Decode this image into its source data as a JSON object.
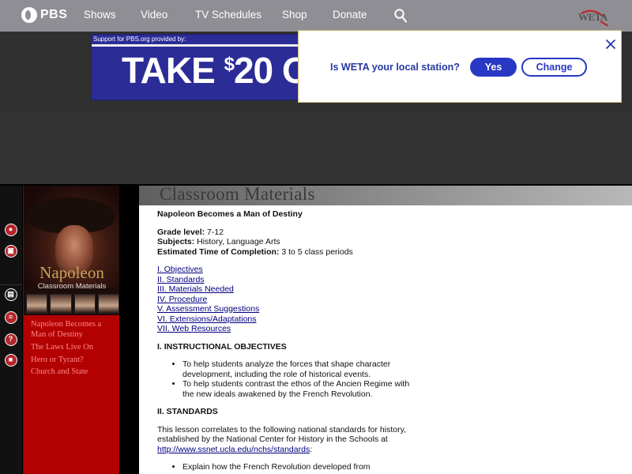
{
  "nav": {
    "brand": "PBS",
    "links": [
      "Shows",
      "Video",
      "TV Schedules",
      "Shop",
      "Donate"
    ],
    "station_logo": "WETA"
  },
  "ad": {
    "support_text": "Support for PBS.org provided by:",
    "headline_prefix": "TAKE ",
    "headline_dollar": "$",
    "headline_value": "20 O"
  },
  "station_popup": {
    "question": "Is WETA your local station?",
    "yes_label": "Yes",
    "change_label": "Change"
  },
  "sidebar": {
    "title": "Napoleon",
    "subtitle": "Classroom Materials",
    "menu": [
      "Napoleon Becomes a Man of Destiny",
      "The Laws Live On",
      "Hero or Tyrant?",
      "Church and State"
    ]
  },
  "main": {
    "header": "Classroom Materials",
    "lesson_title": "Napoleon Becomes a Man of Destiny",
    "grade_label": "Grade level:",
    "grade_value": " 7-12",
    "subjects_label": "Subjects:",
    "subjects_value": " History, Language Arts",
    "time_label": "Estimated Time of Completion:",
    "time_value": " 3 to 5 class periods",
    "toc": [
      "I. Objectives",
      "II. Standards",
      "III. Materials Needed",
      "IV. Procedure",
      "V. Assessment Suggestions",
      "VI. Extensions/Adaptations",
      "VII. Web Resources"
    ],
    "objectives_heading": "I. INSTRUCTIONAL OBJECTIVES",
    "objectives": [
      "To help students analyze the forces that shape character development, including the role of historical events.",
      "To help students contrast the ethos of the Ancien Regime with the new ideals awakened by the French Revolution."
    ],
    "standards_heading": "II. STANDARDS",
    "standards_intro": "This lesson correlates to the following national standards for history, established by the National Center for History in the Schools at ",
    "standards_link": "http://www.ssnet.ucla.edu/nchs/standards",
    "standards_colon": ":",
    "standards_items": [
      "Explain how the French Revolution developed from"
    ]
  },
  "colors": {
    "nav_bg": "#8e8e94",
    "popup_accent": "#2638c4",
    "red_menu": "#b30000"
  }
}
